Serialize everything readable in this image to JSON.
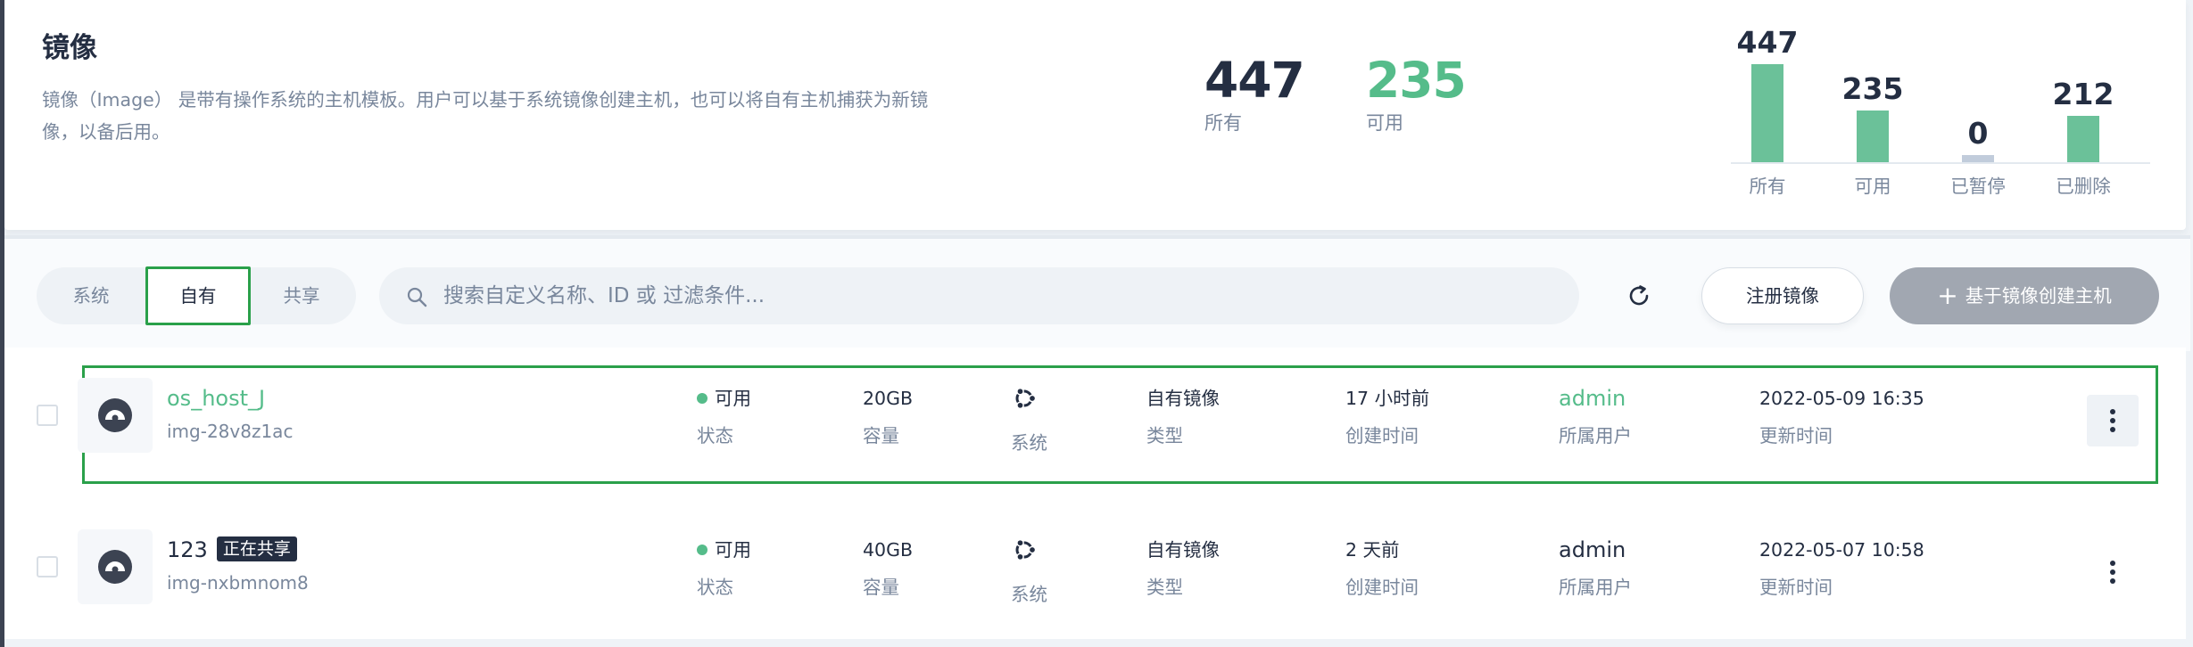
{
  "banner": {
    "title": "镜像",
    "description": "镜像（Image） 是带有操作系统的主机模板。用户可以基于系统镜像创建主机，也可以将自有主机捕获为新镜像，以备后用。",
    "stats": [
      {
        "value": "447",
        "label": "所有"
      },
      {
        "value": "235",
        "label": "可用"
      }
    ],
    "mini_chart": {
      "bars": [
        {
          "label": "所有",
          "value": 447
        },
        {
          "label": "可用",
          "value": 235
        },
        {
          "label": "已暂停",
          "value": 0
        },
        {
          "label": "已删除",
          "value": 212
        }
      ],
      "colors": {
        "bar": "#6bc199",
        "zero_bar": "#c1ccdb"
      }
    }
  },
  "toolbar": {
    "tabs": [
      {
        "label": "系统",
        "active": false
      },
      {
        "label": "自有",
        "active": true
      },
      {
        "label": "共享",
        "active": false
      }
    ],
    "search": {
      "placeholder": "搜索自定义名称、ID 或 过滤条件...",
      "value": "",
      "icon": "search-icon"
    },
    "refresh_icon": "refresh-icon",
    "register_label": "注册镜像",
    "create_label": "基于镜像创建主机"
  },
  "images": [
    {
      "name": "os_host_J",
      "id": "img-28v8z1ac",
      "badge": "",
      "status": "可用",
      "status_label": "状态",
      "size": "20GB",
      "size_label": "容量",
      "os_icon": "ubuntu-icon",
      "os_label": "系统",
      "type": "自有镜像",
      "type_label": "类型",
      "created": "17 小时前",
      "created_label": "创建时间",
      "owner": "admin",
      "owner_label": "所属用户",
      "updated": "2022-05-09 16:35",
      "updated_label": "更新时间"
    },
    {
      "name": "123",
      "id": "img-nxbmnom8",
      "badge": "正在共享",
      "status": "可用",
      "status_label": "状态",
      "size": "40GB",
      "size_label": "容量",
      "os_icon": "ubuntu-icon",
      "os_label": "系统",
      "type": "自有镜像",
      "type_label": "类型",
      "created": "2 天前",
      "created_label": "创建时间",
      "owner": "admin",
      "owner_label": "所属用户",
      "updated": "2022-05-07 10:58",
      "updated_label": "更新时间"
    }
  ],
  "colors": {
    "accent_green": "#55bc8a",
    "highlight_border": "#2aa04a",
    "text_primary": "#242e42",
    "text_secondary": "#79879c",
    "create_button": "#a1a7b1"
  }
}
